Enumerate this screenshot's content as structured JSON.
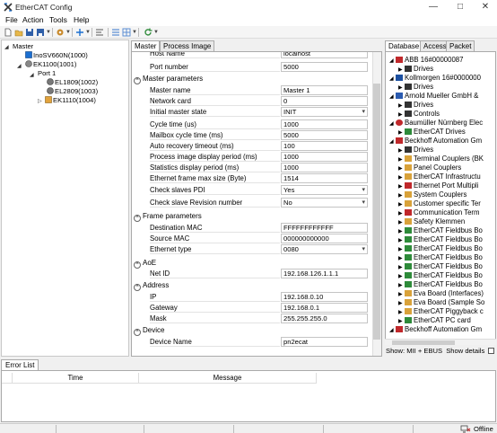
{
  "window": {
    "title": "EtherCAT Config",
    "minimize": "—",
    "maximize": "□",
    "close": "✕"
  },
  "menu": [
    "File",
    "Action",
    "Tools",
    "Help"
  ],
  "tree": {
    "nodes": [
      {
        "label": "Master"
      },
      {
        "label": "InoSV660N(1000)"
      },
      {
        "label": "EK1100(1001)"
      },
      {
        "label": "Port 1"
      },
      {
        "label": "EL1809(1002)"
      },
      {
        "label": "EL2809(1003)"
      },
      {
        "label": "EK1110(1004)"
      }
    ]
  },
  "center_tabs": [
    "Master",
    "Process Image"
  ],
  "props": {
    "clipped_label": "Host Name",
    "clipped_value": "localhost",
    "port_number_label": "Port number",
    "port_number_value": "5000",
    "master_params_title": "Master parameters",
    "master_params": [
      {
        "label": "Master name",
        "value": "Master 1"
      },
      {
        "label": "Network card",
        "value": "0"
      },
      {
        "label": "Initial master state",
        "value": "INIT"
      },
      {
        "label": "Cycle time (us)",
        "value": "1000"
      },
      {
        "label": "Mailbox cycle time (ms)",
        "value": "5000"
      },
      {
        "label": "Auto recovery timeout (ms)",
        "value": "100"
      },
      {
        "label": "Process image display period (ms)",
        "value": "1000"
      },
      {
        "label": "Statistics display period (ms)",
        "value": "1000"
      },
      {
        "label": "Ethernet frame max size (Byte)",
        "value": "1514"
      },
      {
        "label": "Check slaves PDI",
        "value": "Yes"
      },
      {
        "label": "Check slave Revision number",
        "value": "No"
      }
    ],
    "frame_params_title": "Frame parameters",
    "frame_params": [
      {
        "label": "Destination MAC",
        "value": "FFFFFFFFFFFF"
      },
      {
        "label": "Source MAC",
        "value": "000000000000"
      },
      {
        "label": "Ethernet type",
        "value": "0080"
      }
    ],
    "aoe_title": "AoE",
    "aoe": [
      {
        "label": "Net ID",
        "value": "192.168.126.1.1.1"
      }
    ],
    "address_title": "Address",
    "address": [
      {
        "label": "IP",
        "value": "192.168.0.10"
      },
      {
        "label": "Gateway",
        "value": "192.168.0.1"
      },
      {
        "label": "Mask",
        "value": "255.255.255.0"
      }
    ],
    "device_title": "Device",
    "device": [
      {
        "label": "Device Name",
        "value": "pn2ecat"
      }
    ]
  },
  "right_tabs": [
    "Database",
    "Access",
    "Packet"
  ],
  "database": [
    {
      "label": "ABB  16#00000087"
    },
    {
      "label": "Drives"
    },
    {
      "label": "Kollmorgen  16#0000000"
    },
    {
      "label": "Drives"
    },
    {
      "label": "Arnold Mueller GmbH &"
    },
    {
      "label": "Drives"
    },
    {
      "label": "Controls"
    },
    {
      "label": "Baumüller Nürnberg Elec"
    },
    {
      "label": "EtherCAT Drives"
    },
    {
      "label": "Beckhoff Automation Gm"
    },
    {
      "label": "Drives"
    },
    {
      "label": "Terminal Couplers (BK"
    },
    {
      "label": "Panel Couplers"
    },
    {
      "label": "EtherCAT Infrastructu"
    },
    {
      "label": "Ethernet Port Multipli"
    },
    {
      "label": "System Couplers"
    },
    {
      "label": "Customer specific Ter"
    },
    {
      "label": "Communication Term"
    },
    {
      "label": "Safety Klemmen"
    },
    {
      "label": "EtherCAT Fieldbus Bo"
    },
    {
      "label": "EtherCAT Fieldbus Bo"
    },
    {
      "label": "EtherCAT Fieldbus Bo"
    },
    {
      "label": "EtherCAT Fieldbus Bo"
    },
    {
      "label": "EtherCAT Fieldbus Bo"
    },
    {
      "label": "EtherCAT Fieldbus Bo"
    },
    {
      "label": "EtherCAT Fieldbus Bo"
    },
    {
      "label": "Eva Board (Interfaces)"
    },
    {
      "label": "Eva Board (Sample So"
    },
    {
      "label": "EtherCAT Piggyback c"
    },
    {
      "label": "EtherCAT PC card"
    },
    {
      "label": "Beckhoff Automation Gm"
    }
  ],
  "show_line": "Show: MII + EBUS",
  "show_details": "Show details",
  "error_list": {
    "tab": "Error List",
    "columns": [
      "Time",
      "Message"
    ]
  },
  "status": {
    "state": "Offline"
  },
  "colors": {
    "accent_blue": "#1b6fd1",
    "link_green": "#2e8b3a",
    "vendor_red": "#c0282b"
  }
}
